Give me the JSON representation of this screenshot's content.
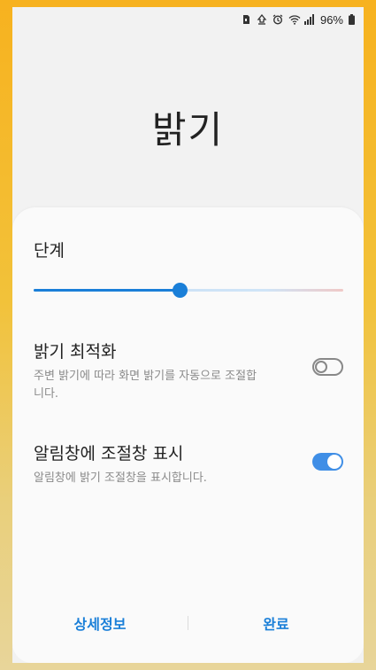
{
  "status_bar": {
    "icons": [
      "sd-card-icon",
      "upload-icon",
      "alarm-icon",
      "wifi-icon",
      "signal-icon"
    ],
    "battery": "96%"
  },
  "page": {
    "title": "밝기"
  },
  "dialog": {
    "level_label": "단계",
    "brightness_level": 0.47,
    "settings": [
      {
        "title": "밝기 최적화",
        "description": "주변 밝기에 따라 화면 밝기를 자동으로 조절합니다.",
        "enabled": false
      },
      {
        "title": "알림창에 조절창 표시",
        "description": "알림창에 밝기 조절창을 표시합니다.",
        "enabled": true
      }
    ],
    "footer": {
      "details_label": "상세정보",
      "done_label": "완료"
    }
  },
  "colors": {
    "accent": "#1a7fd8",
    "toggle_on": "#3f8ee6"
  }
}
